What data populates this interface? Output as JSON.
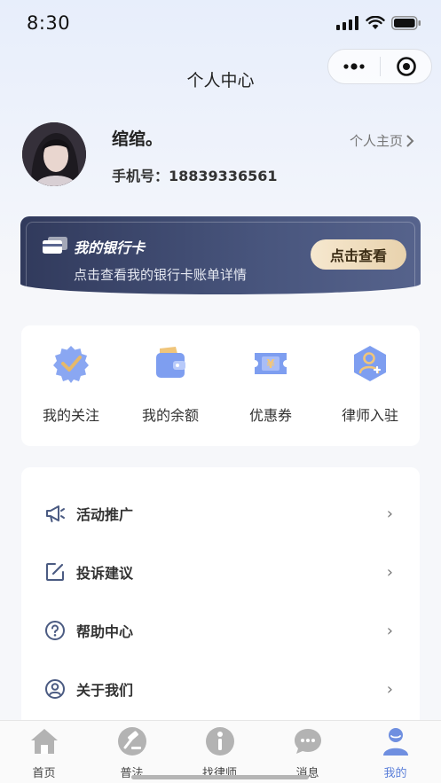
{
  "status_bar": {
    "time": "8:30"
  },
  "nav": {
    "title": "个人中心"
  },
  "profile": {
    "name": "绾绾。",
    "phone_label": "手机号：",
    "phone": "18839336561",
    "homepage_link": "个人主页"
  },
  "bank_card": {
    "title": "我的银行卡",
    "subtitle": "点击查看我的银行卡账单详情",
    "button": "点击查看"
  },
  "quick_actions": [
    {
      "label": "我的关注",
      "icon": "badge-check-icon"
    },
    {
      "label": "我的余额",
      "icon": "wallet-icon"
    },
    {
      "label": "优惠券",
      "icon": "coupon-icon"
    },
    {
      "label": "律师入驻",
      "icon": "lawyer-register-icon"
    }
  ],
  "menu": [
    {
      "label": "活动推广",
      "icon": "megaphone-icon"
    },
    {
      "label": "投诉建议",
      "icon": "edit-icon"
    },
    {
      "label": "帮助中心",
      "icon": "help-icon"
    },
    {
      "label": "关于我们",
      "icon": "user-circle-icon"
    }
  ],
  "tabs": [
    {
      "label": "首页",
      "icon": "home-icon"
    },
    {
      "label": "普法",
      "icon": "gavel-icon"
    },
    {
      "label": "找律师",
      "icon": "lawyer-icon"
    },
    {
      "label": "消息",
      "icon": "message-icon"
    },
    {
      "label": "我的",
      "icon": "profile-icon",
      "active": true
    }
  ],
  "colors": {
    "accent": "#5b7fd9",
    "card_dark": "#3a4468",
    "gold_button": "#f0dfc0",
    "icon_blue": "#7e9ef0"
  }
}
